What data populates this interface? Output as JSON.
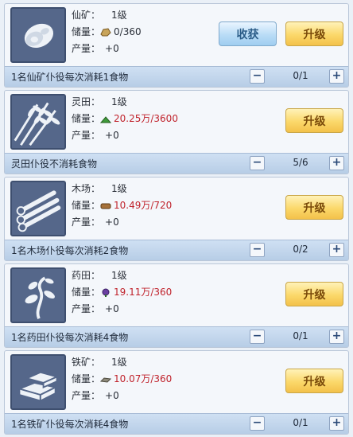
{
  "buildings": [
    {
      "name_label": "仙矿：",
      "level": "1级",
      "storage_label": "储量：",
      "storage": "0/360",
      "storage_red": false,
      "output_label": "产量：",
      "output": "+0",
      "harvest_label": "收获",
      "upgrade_label": "升级",
      "bar_text": "1名仙矿仆役每次消耗1食物",
      "count": "0/1",
      "minus": "−",
      "plus": "+",
      "icon": "ore-icon",
      "res_icon": "stone-res-icon"
    },
    {
      "name_label": "灵田：",
      "level": "1级",
      "storage_label": "储量：",
      "storage": "20.25万/3600",
      "storage_red": true,
      "output_label": "产量：",
      "output": "+0",
      "upgrade_label": "升级",
      "bar_text": "灵田仆役不消耗食物",
      "count": "5/6",
      "minus": "−",
      "plus": "+",
      "icon": "wheat-icon",
      "res_icon": "grain-res-icon"
    },
    {
      "name_label": "木场：",
      "level": "1级",
      "storage_label": "储量：",
      "storage": "10.49万/720",
      "storage_red": true,
      "output_label": "产量：",
      "output": "+0",
      "upgrade_label": "升级",
      "bar_text": "1名木场仆役每次消耗2食物",
      "count": "0/2",
      "minus": "−",
      "plus": "+",
      "icon": "logs-icon",
      "res_icon": "wood-res-icon"
    },
    {
      "name_label": "药田：",
      "level": "1级",
      "storage_label": "储量：",
      "storage": "19.11万/360",
      "storage_red": true,
      "output_label": "产量：",
      "output": "+0",
      "upgrade_label": "升级",
      "bar_text": "1名药田仆役每次消耗4食物",
      "count": "0/1",
      "minus": "−",
      "plus": "+",
      "icon": "herb-icon",
      "res_icon": "herb-res-icon"
    },
    {
      "name_label": "铁矿：",
      "level": "1级",
      "storage_label": "储量：",
      "storage": "10.07万/360",
      "storage_red": true,
      "output_label": "产量：",
      "output": "+0",
      "upgrade_label": "升级",
      "bar_text": "1名铁矿仆役每次消耗4食物",
      "count": "0/1",
      "minus": "−",
      "plus": "+",
      "icon": "iron-ingot-icon",
      "res_icon": "iron-res-icon"
    }
  ],
  "colors": {
    "red": "#c0232c",
    "icon_bg": "#55678a",
    "upgrade_btn": "#fbd86a",
    "harvest_btn": "#b9dcf6",
    "bar": "#c4d7ee"
  }
}
